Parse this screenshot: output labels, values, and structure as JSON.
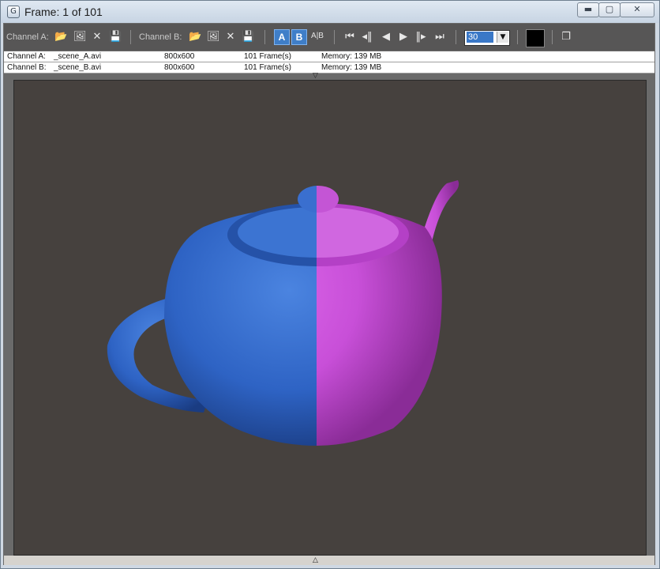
{
  "window": {
    "title": "Frame: 1 of 101",
    "app_icon_glyph": "G",
    "minimize_glyph": "▬",
    "maximize_glyph": "▢",
    "close_glyph": "✕"
  },
  "toolbar": {
    "channel_a_label": "Channel A:",
    "channel_b_label": "Channel B:",
    "icons_a": [
      "open-folder-icon",
      "load-image-icon",
      "clear-icon",
      "save-icon"
    ],
    "icons_b": [
      "open-folder-icon",
      "load-image-icon",
      "clear-icon",
      "save-icon"
    ],
    "view_a_label": "A",
    "view_b_label": "B",
    "split_label": "A|B",
    "playback_glyphs": {
      "go_start": "⏮",
      "prev_key": "◂‖",
      "play_reverse": "◀",
      "play": "▶",
      "next_key": "‖▸",
      "go_end": "⏭"
    },
    "frame_rate_value": "30",
    "background_color": "#000000"
  },
  "channels": [
    {
      "label": "Channel A:",
      "file": "_scene_A.avi",
      "resolution": "800x600",
      "frames": "101 Frame(s)",
      "memory": "Memory: 139 MB"
    },
    {
      "label": "Channel B:",
      "file": "_scene_B.avi",
      "resolution": "800x600",
      "frames": "101 Frame(s)",
      "memory": "Memory: 139 MB"
    }
  ],
  "viewport": {
    "content": "teapot-render",
    "left_color": "#2e63c4",
    "right_color": "#c84fd8",
    "background": "#46413e"
  }
}
